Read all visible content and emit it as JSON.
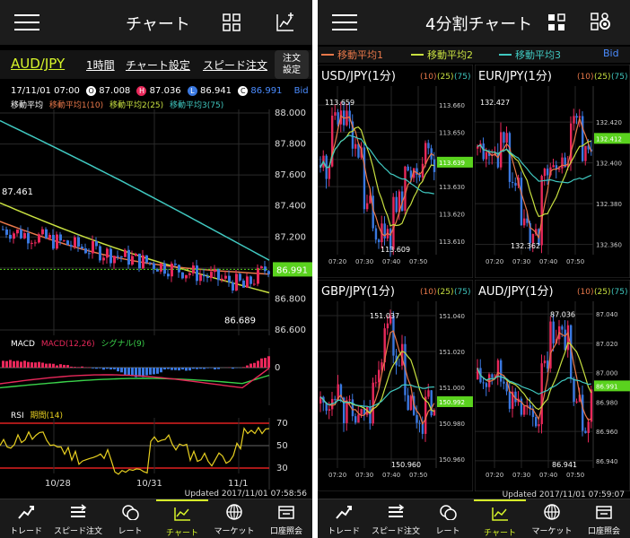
{
  "left": {
    "header": {
      "title": "チャート"
    },
    "toolbar": {
      "pair": "AUD/JPY",
      "timeframe": "1時間",
      "chart_settings": "チャート設定",
      "speed_order": "スピード注文",
      "order_settings_line1": "注文",
      "order_settings_line2": "設定"
    },
    "ohlc": {
      "datetime": "17/11/01 07:00",
      "open_badge": "O",
      "open": "87.008",
      "high_badge": "H",
      "high": "87.036",
      "low_badge": "L",
      "low": "86.941",
      "close_badge": "C",
      "close": "86.991",
      "side": "Bid"
    },
    "ma_legend": {
      "title": "移動平均",
      "ma1": "移動平均1(10)",
      "ma2": "移動平均2(25)",
      "ma3": "移動平均3(75)"
    },
    "macd_legend": {
      "title": "MACD",
      "macd": "MACD(12,26)",
      "signal": "シグナル(9)"
    },
    "rsi_legend": {
      "title": "RSI",
      "period": "期間(14)"
    },
    "updated": "Updated 2017/11/01 07:58:56"
  },
  "right": {
    "header": {
      "title": "4分割チャート"
    },
    "legend": {
      "ma1": "移動平均1",
      "ma2": "移動平均2",
      "ma3": "移動平均3",
      "side": "Bid"
    },
    "updated": "Updated 2017/11/01 07:59:07"
  },
  "tabs": [
    {
      "label": "トレード",
      "icon": "trade-icon"
    },
    {
      "label": "スピード注文",
      "icon": "speed-order-icon"
    },
    {
      "label": "レート",
      "icon": "rate-icon"
    },
    {
      "label": "チャート",
      "icon": "chart-icon",
      "active": true
    },
    {
      "label": "マーケット",
      "icon": "globe-icon"
    },
    {
      "label": "口座照会",
      "icon": "account-icon"
    }
  ],
  "colors": {
    "bull": "#e8285a",
    "bear": "#3a78e0",
    "ma1": "#e8784a",
    "ma2": "#c8e040",
    "ma3": "#40c8c0",
    "accent": "#d7f52a",
    "price_tag": "#5ad21e",
    "bid": "#4a8cff"
  },
  "chart_data": [
    {
      "type": "candlestick",
      "title": "AUD/JPY",
      "timeframe": "1時間",
      "y_ticks": [
        "88.000",
        "87.800",
        "87.600",
        "87.400",
        "87.200",
        "87.000",
        "86.800",
        "86.600"
      ],
      "ylim": [
        86.6,
        88.0
      ],
      "x_ticks": [
        "10/28",
        "10/31",
        "11/1"
      ],
      "current_price": "86.991",
      "high_label": "87.461",
      "low_label": "86.689",
      "ma3_start": 87.95,
      "ma3_end": 87.05,
      "ma2_start": 87.42,
      "ma2_end": 86.84,
      "ma1_start": 87.3,
      "ma1_end": 86.96,
      "subplots": [
        {
          "type": "macd",
          "zero_tick": "0"
        },
        {
          "type": "rsi",
          "ticks": [
            "70",
            "50",
            "30"
          ]
        }
      ]
    },
    {
      "type": "candlestick",
      "title": "USD/JPY(1分)",
      "params": [
        "(10)",
        "(25)",
        "(75)"
      ],
      "y_ticks": [
        "113.660",
        "113.650",
        "113.640",
        "113.630",
        "113.620",
        "113.610"
      ],
      "ylim": [
        113.605,
        113.665
      ],
      "x_ticks": [
        "07:20",
        "07:30",
        "07:40",
        "07:50"
      ],
      "current_price": "113.639",
      "high_label": "113.659",
      "low_label": "113.609"
    },
    {
      "type": "candlestick",
      "title": "EUR/JPY(1分)",
      "params": [
        "(10)",
        "(25)",
        "(75)"
      ],
      "y_ticks": [
        "132.420",
        "132.400",
        "132.380",
        "132.360"
      ],
      "ylim": [
        132.355,
        132.435
      ],
      "x_ticks": [
        "07:20",
        "07:30",
        "07:40",
        "07:50"
      ],
      "current_price": "132.412",
      "high_label": "132.427",
      "low_label": "132.362"
    },
    {
      "type": "candlestick",
      "title": "GBP/JPY(1分)",
      "params": [
        "(10)",
        "(25)",
        "(75)"
      ],
      "y_ticks": [
        "151.040",
        "151.020",
        "151.000",
        "150.980",
        "150.960"
      ],
      "ylim": [
        150.955,
        151.045
      ],
      "x_ticks": [
        "07:20",
        "07:30",
        "07:40",
        "07:50"
      ],
      "current_price": "150.992",
      "high_label": "151.037",
      "low_label": "150.960"
    },
    {
      "type": "candlestick",
      "title": "AUD/JPY(1分)",
      "params": [
        "(10)",
        "(25)",
        "(75)"
      ],
      "y_ticks": [
        "87.040",
        "87.020",
        "87.000",
        "86.980",
        "86.960",
        "86.940"
      ],
      "ylim": [
        86.935,
        87.045
      ],
      "x_ticks": [
        "07:20",
        "07:30",
        "07:40",
        "07:50"
      ],
      "current_price": "86.991",
      "high_label": "87.036",
      "low_label": "86.941"
    }
  ]
}
